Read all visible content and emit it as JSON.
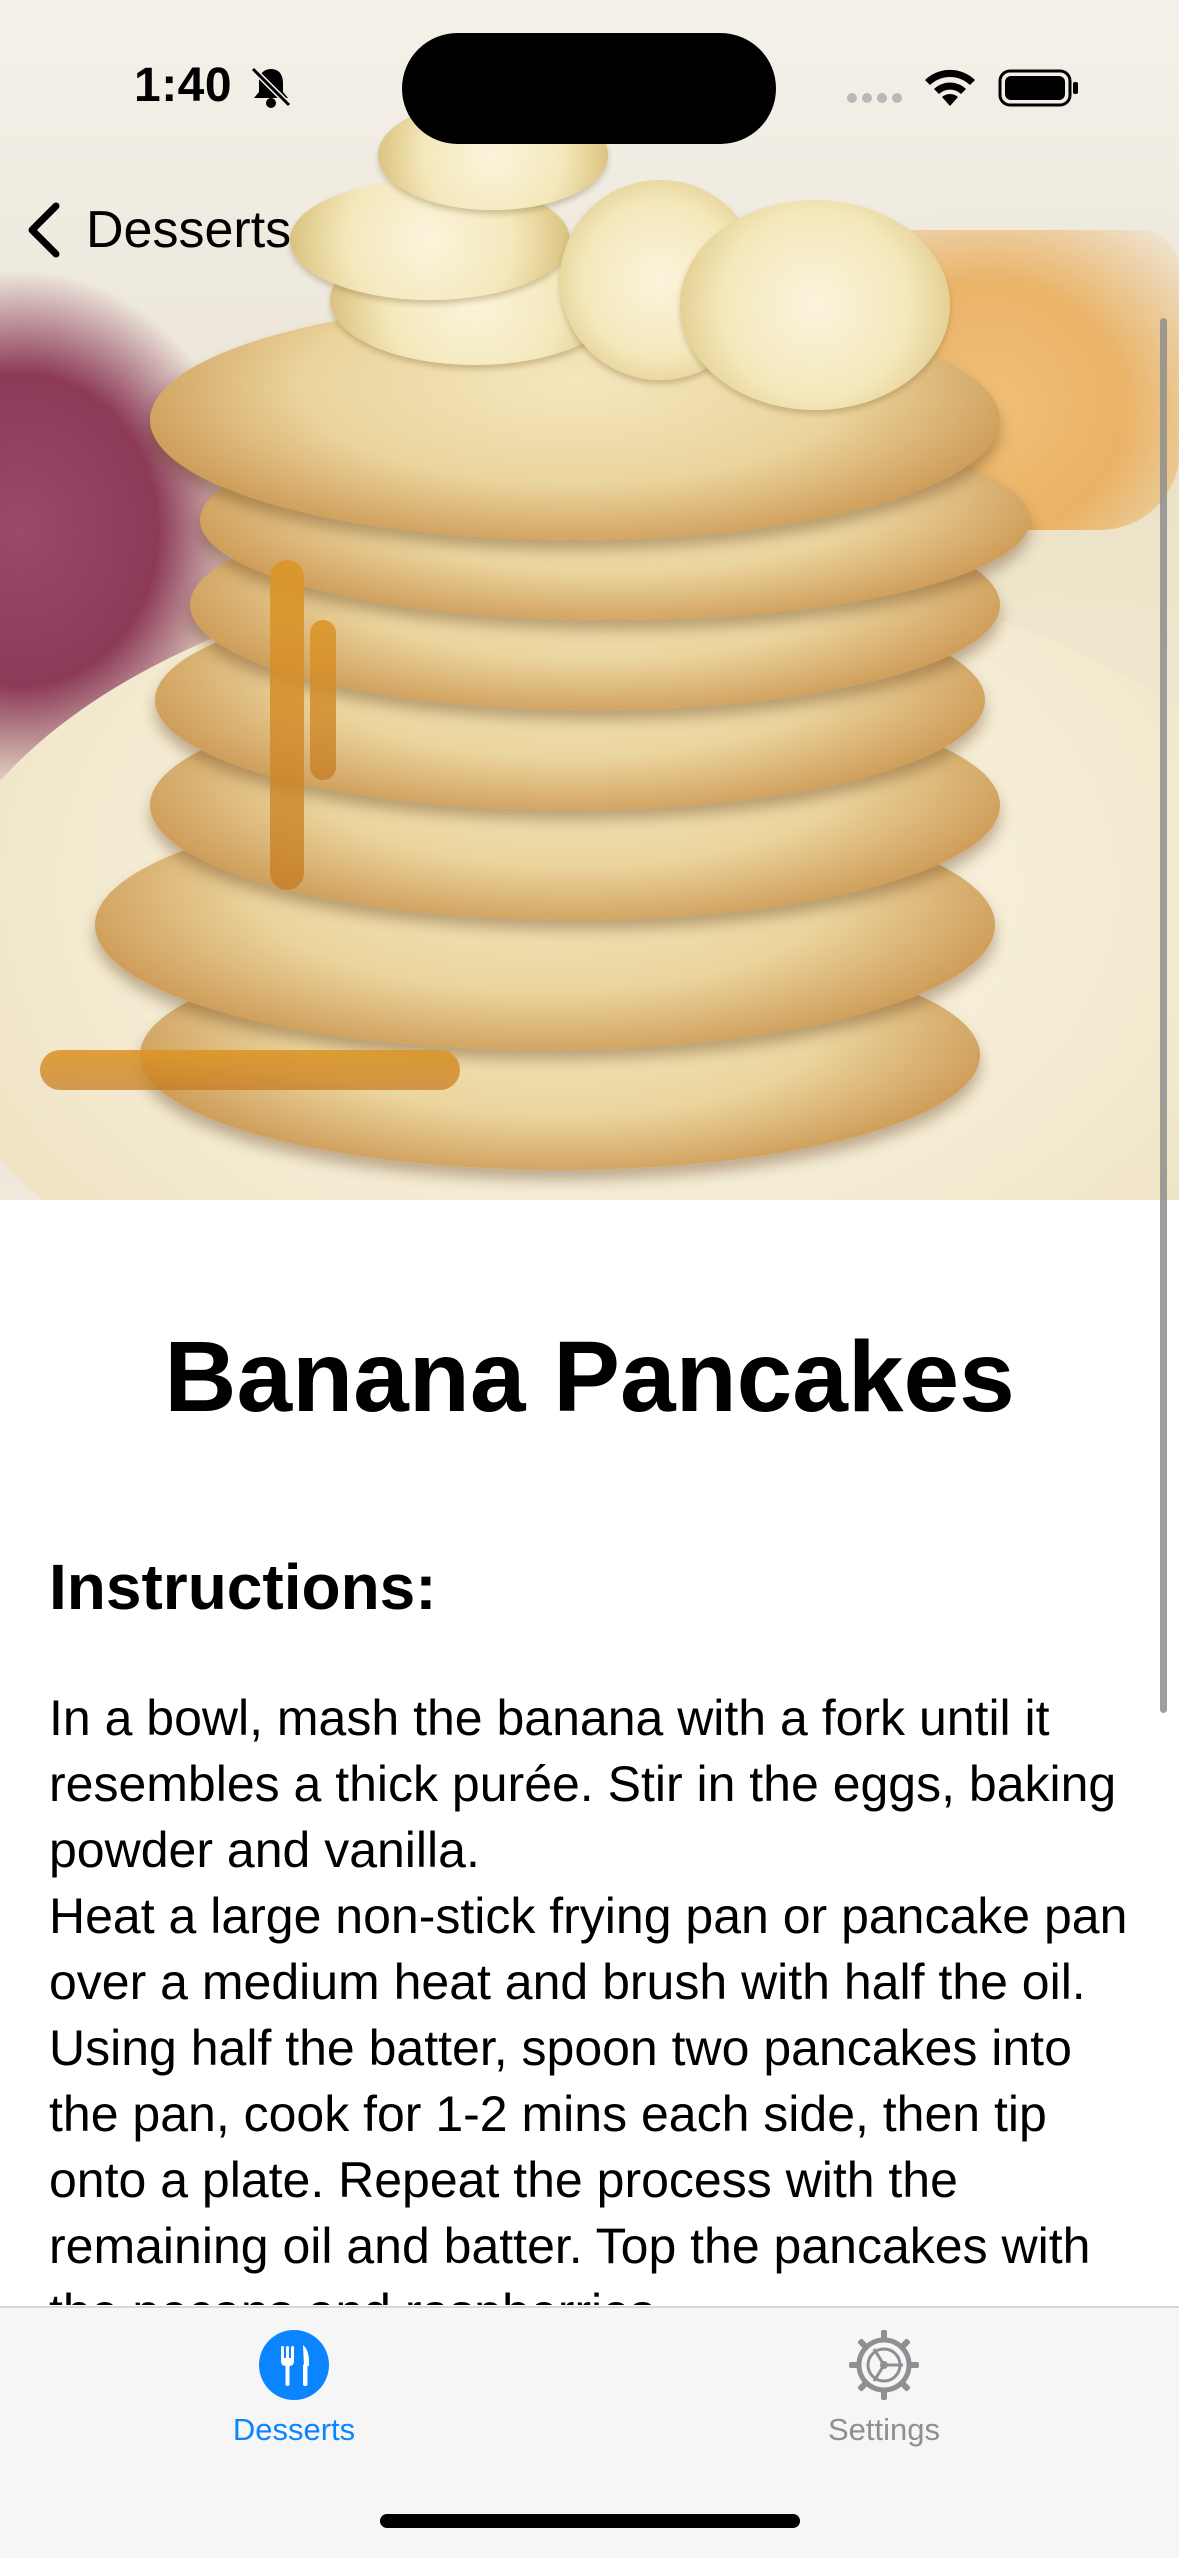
{
  "status_bar": {
    "time": "1:40"
  },
  "nav": {
    "back_label": "Desserts"
  },
  "recipe": {
    "title": "Banana Pancakes",
    "instructions_heading": "Instructions:",
    "instructions_text": "In a bowl, mash the banana with a fork until it resembles a thick purée. Stir in the eggs, baking powder and vanilla.\nHeat a large non-stick frying pan or pancake pan over a medium heat and brush with half the oil. Using half the batter, spoon two pancakes into the pan, cook for 1-2 mins each side, then tip onto a plate. Repeat the process with the remaining oil and batter. Top the pancakes with the pecans and raspberries."
  },
  "tab_bar": {
    "tabs": [
      {
        "label": "Desserts",
        "icon": "fork-knife-icon",
        "selected": true
      },
      {
        "label": "Settings",
        "icon": "gear-icon",
        "selected": false
      }
    ]
  },
  "colors": {
    "accent": "#0A84FF",
    "tab_inactive": "#8E8E93"
  }
}
